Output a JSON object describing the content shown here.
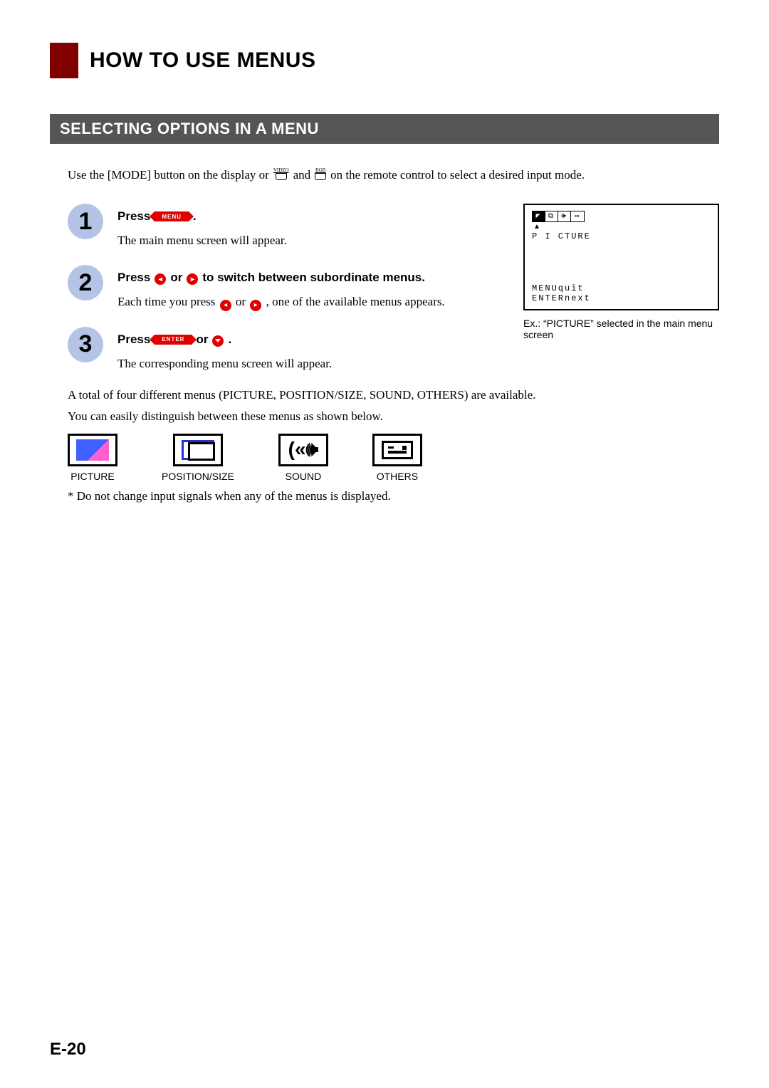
{
  "title": "HOW TO USE MENUS",
  "section": "SELECTING OPTIONS IN A MENU",
  "intro_a": "Use the [MODE] button on the display or",
  "intro_b": "and",
  "intro_c": "on the remote control to select a desired input mode.",
  "remote1": "VIDEO",
  "remote2": "RGB",
  "steps": [
    {
      "num": "1",
      "press": "Press",
      "btn": "MENU",
      "after": ".",
      "desc": "The main menu screen will appear."
    },
    {
      "num": "2",
      "press": "Press",
      "or": "or",
      "after": "to switch between subordinate menus.",
      "desc_a": "Each time you press",
      "desc_b": "or",
      "desc_c": ", one of the available menus appears."
    },
    {
      "num": "3",
      "press": "Press",
      "btn": "ENTER",
      "or": "or",
      "after": ".",
      "desc": "The corresponding menu screen will appear."
    }
  ],
  "screen": {
    "label": "P I CTURE",
    "line1": "MENUquit",
    "line2": "ENTERnext",
    "caption": "Ex.: “PICTURE” selected in the main menu screen"
  },
  "notes": {
    "total": "A total of four different menus (PICTURE, POSITION/SIZE, SOUND, OTHERS) are available.",
    "dist": "You can easily distinguish between these menus as shown below."
  },
  "menus": [
    "PICTURE",
    "POSITION/SIZE",
    "SOUND",
    "OTHERS"
  ],
  "footnote": "* Do not change input signals when any of the menus is displayed.",
  "page_num": "E-20"
}
